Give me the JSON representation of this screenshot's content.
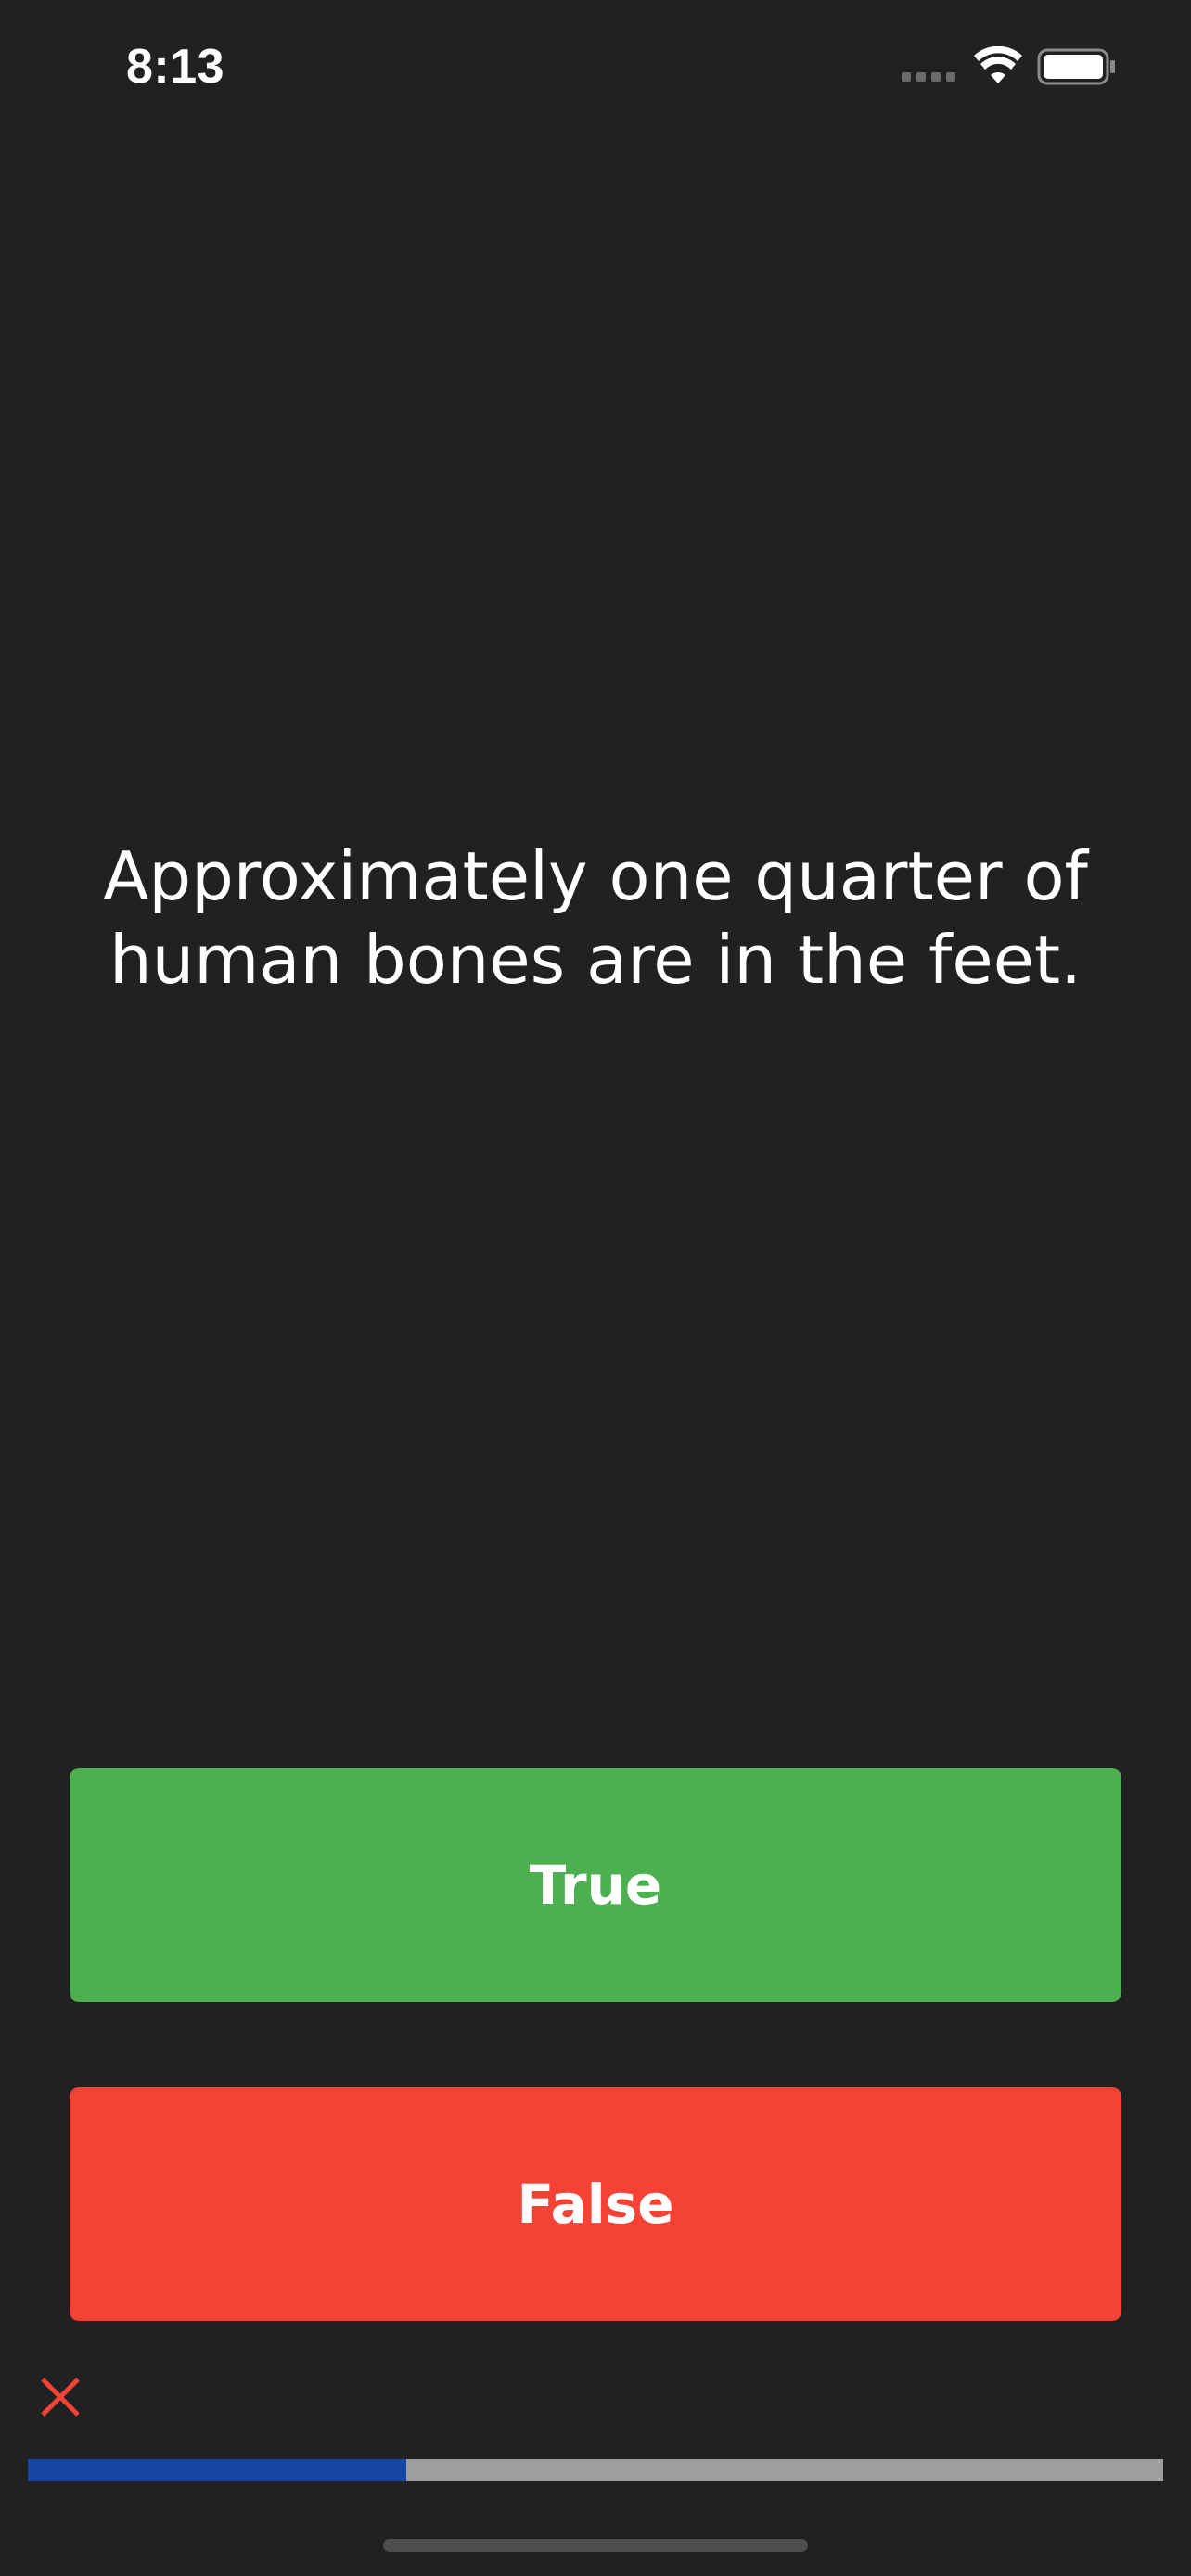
{
  "status_bar": {
    "time": "8:13",
    "signal_icon": "cellular-signal-icon",
    "wifi_icon": "wifi-icon",
    "battery_icon": "battery-icon"
  },
  "quiz": {
    "question": "Approximately one quarter of human bones are in the feet.",
    "true_label": "True",
    "false_label": "False",
    "true_color": "#4caf50",
    "false_color": "#f44336"
  },
  "score_keeper": {
    "icons": [
      "close-icon"
    ],
    "wrong_mark_color": "#f44336"
  },
  "progress": {
    "fraction": 0.333,
    "fill_color": "#1546a6",
    "track_color": "#9e9e9e"
  }
}
